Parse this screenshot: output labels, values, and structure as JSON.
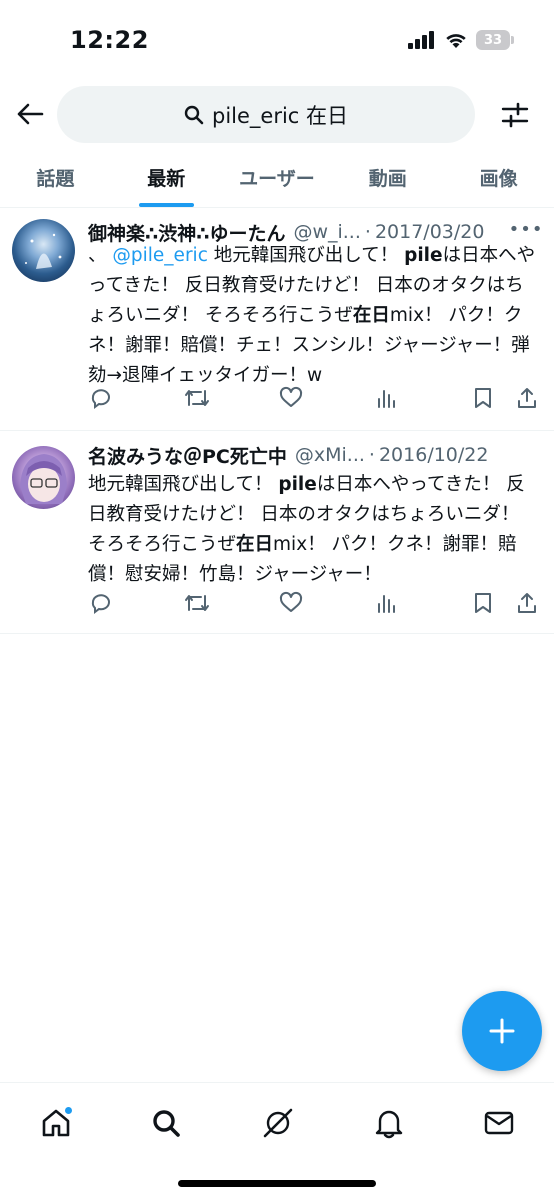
{
  "status_bar": {
    "time": "12:22",
    "battery": "33",
    "icons": [
      "signal-icon",
      "wifi-icon",
      "battery-icon"
    ]
  },
  "search": {
    "query": "pile_eric 在日",
    "icon": "search-icon"
  },
  "tabs": [
    {
      "label": "話題",
      "active": false
    },
    {
      "label": "最新",
      "active": true
    },
    {
      "label": "ユーザー",
      "active": false
    },
    {
      "label": "動画",
      "active": false
    },
    {
      "label": "画像",
      "active": false
    }
  ],
  "tweets": [
    {
      "display_name": "御神楽∴渋神∴ゆーたん",
      "handle": "@w_i...",
      "sep": "·",
      "date": "2017/03/20",
      "body": {
        "prefix": "、",
        "mention": "@pile_eric",
        "t1": " 地元韓国飛び出して！ ",
        "b1": "pile",
        "t2": "は日本へやってきた！ 反日教育受けたけど！ 日本のオタクはちょろいニダ！ そろそろ行こうぜ",
        "b2": "在日",
        "t3": "mix！ パク！クネ！謝罪！賠償！チェ！スンシル！ジャージャー！弾劾→退陣イェッタイガー！w"
      }
    },
    {
      "display_name": "名波みうな＠PC死亡中",
      "handle": "@xMi...",
      "sep": "·",
      "date": "2016/10/22",
      "body": {
        "t1": "地元韓国飛び出して！ ",
        "b1": "pile",
        "t2": "は日本へやってきた！ 反日教育受けたけど！ 日本のオタクはちょろいニダ！ そろそろ行こうぜ",
        "b2": "在日",
        "t3": "mix！ パク！クネ！謝罪！賠償！慰安婦！竹島！ジャージャー！"
      }
    }
  ],
  "more_label": "•••",
  "tweet_actions": [
    "reply-icon",
    "retweet-icon",
    "like-icon",
    "views-icon",
    "bookmark-icon",
    "share-icon"
  ],
  "bottom_nav": [
    "home-icon",
    "search-icon",
    "grok-icon",
    "notifications-icon",
    "messages-icon"
  ],
  "colors": {
    "accent": "#1d9bf0",
    "text": "#0f1419",
    "secondary": "#536471",
    "pill_bg": "#eff3f4"
  }
}
